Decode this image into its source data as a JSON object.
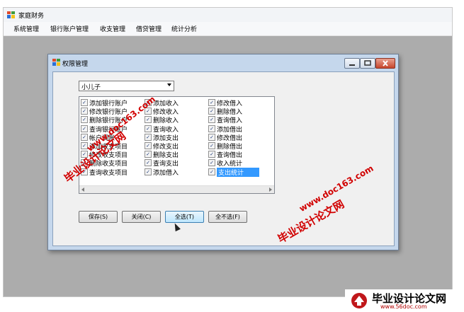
{
  "window": {
    "title": "家庭财务"
  },
  "menu": [
    "系统管理",
    "银行账户管理",
    "收支管理",
    "借贷管理",
    "统计分析"
  ],
  "dialog": {
    "title": "权限管理",
    "user_select": "小儿子",
    "checklist": {
      "col1": [
        "添加银行账户",
        "修改银行账户",
        "删除银行账户",
        "查询银行账户",
        "帐户调账",
        "添加收支项目",
        "修改收支项目",
        "删除收支项目",
        "查询收支项目"
      ],
      "col2": [
        "添加收入",
        "修改收入",
        "删除收入",
        "查询收入",
        "添加支出",
        "修改支出",
        "删除支出",
        "查询支出",
        "添加借入"
      ],
      "col3": [
        "修改借入",
        "删除借入",
        "查询借入",
        "添加借出",
        "修改借出",
        "删除借出",
        "查询借出",
        "收入统计",
        "支出统计"
      ]
    },
    "buttons": {
      "save": "保存(S)",
      "close": "关闭(C)",
      "select_all": "全选(T)",
      "select_none": "全不选(F)"
    }
  },
  "watermarks": {
    "site_name": "毕业设计论文网",
    "site_url": "www.doc163.com"
  },
  "logo": {
    "name": "毕业设计论文网",
    "url": "www.56doc.com"
  },
  "colors": {
    "selection": "#3399ff",
    "watermark": "#d10000",
    "client_bg": "#acacac",
    "dialog_frame": "#c5d7ec"
  }
}
